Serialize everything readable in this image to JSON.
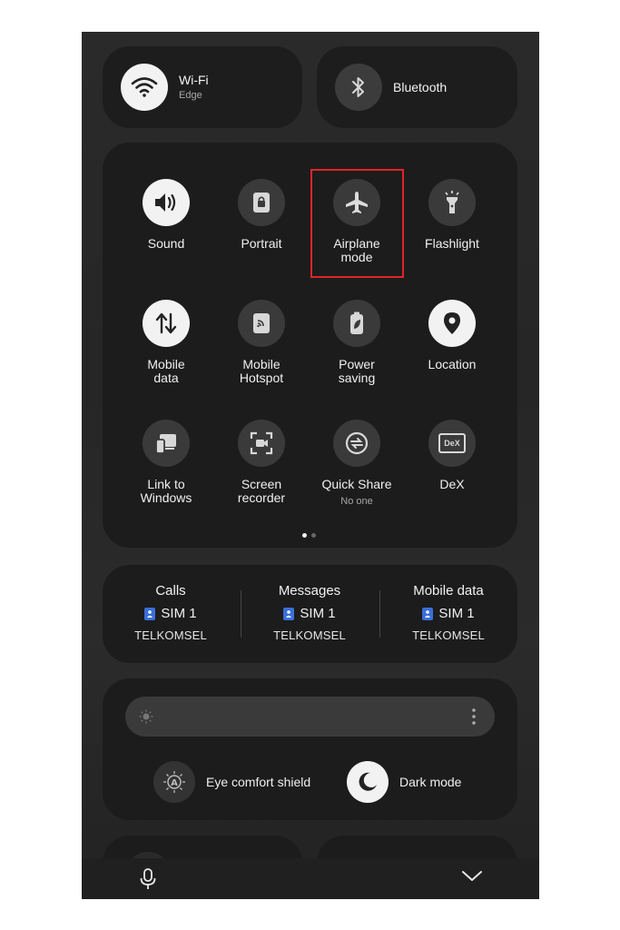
{
  "top_tiles": {
    "wifi": {
      "title": "Wi-Fi",
      "subtitle": "Edge",
      "icon": "wifi-icon",
      "active": true
    },
    "bluetooth": {
      "title": "Bluetooth",
      "icon": "bluetooth-icon",
      "active": false
    }
  },
  "quick_settings": [
    {
      "label": "Sound",
      "icon": "sound-icon",
      "active": true
    },
    {
      "label": "Portrait",
      "icon": "portrait-lock-icon",
      "active": false
    },
    {
      "label": "Airplane\nmode",
      "icon": "airplane-icon",
      "active": false,
      "highlighted": true
    },
    {
      "label": "Flashlight",
      "icon": "flashlight-icon",
      "active": false
    },
    {
      "label": "Mobile\ndata",
      "icon": "mobile-data-icon",
      "active": true
    },
    {
      "label": "Mobile\nHotspot",
      "icon": "hotspot-icon",
      "active": false
    },
    {
      "label": "Power\nsaving",
      "icon": "power-saving-icon",
      "active": false
    },
    {
      "label": "Location",
      "icon": "location-icon",
      "active": true
    },
    {
      "label": "Link to\nWindows",
      "icon": "link-to-windows-icon",
      "active": false
    },
    {
      "label": "Screen\nrecorder",
      "icon": "screen-recorder-icon",
      "active": false
    },
    {
      "label": "Quick Share",
      "sub": "No one",
      "icon": "quick-share-icon",
      "active": false
    },
    {
      "label": "DeX",
      "icon": "dex-icon",
      "icon_text": "DeX",
      "active": false
    }
  ],
  "page_indicator": {
    "pages": 2,
    "current": 1
  },
  "sim": [
    {
      "title": "Calls",
      "sim": "SIM 1",
      "carrier": "TELKOMSEL"
    },
    {
      "title": "Messages",
      "sim": "SIM 1",
      "carrier": "TELKOMSEL"
    },
    {
      "title": "Mobile data",
      "sim": "SIM 1",
      "carrier": "TELKOMSEL"
    }
  ],
  "brightness": {
    "eye_comfort_label": "Eye comfort shield",
    "dark_mode_label": "Dark mode",
    "dark_mode_active": true
  },
  "colors": {
    "highlight": "#e0242a",
    "sim_badge": "#3a6fd8",
    "tile_on": "#f2f2f2",
    "tile_off": "#3a3a3a"
  }
}
